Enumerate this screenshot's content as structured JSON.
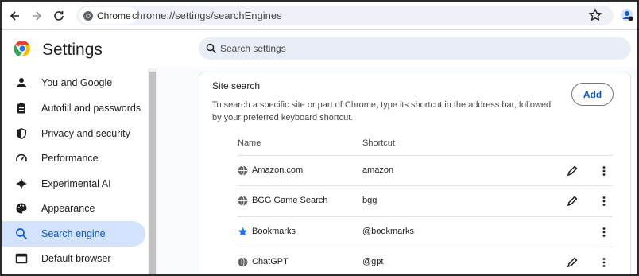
{
  "browser": {
    "chip_label": "Chrome",
    "url": "chrome://settings/searchEngines"
  },
  "header": {
    "title": "Settings",
    "search_placeholder": "Search settings"
  },
  "sidebar": {
    "items": [
      {
        "label": "You and Google",
        "icon": "person-icon"
      },
      {
        "label": "Autofill and passwords",
        "icon": "clipboard-icon"
      },
      {
        "label": "Privacy and security",
        "icon": "shield-icon"
      },
      {
        "label": "Performance",
        "icon": "gauge-icon"
      },
      {
        "label": "Experimental AI",
        "icon": "sparkle-icon"
      },
      {
        "label": "Appearance",
        "icon": "palette-icon"
      },
      {
        "label": "Search engine",
        "icon": "search-icon",
        "active": true
      },
      {
        "label": "Default browser",
        "icon": "browser-icon"
      }
    ]
  },
  "site_search": {
    "title": "Site search",
    "description": "To search a specific site or part of Chrome, type its shortcut in the address bar, followed by your preferred keyboard shortcut.",
    "add_label": "Add",
    "columns": {
      "name": "Name",
      "shortcut": "Shortcut"
    },
    "rows": [
      {
        "name": "Amazon.com",
        "shortcut": "amazon",
        "icon": "globe-icon",
        "editable": true
      },
      {
        "name": "BGG Game Search",
        "shortcut": "bgg",
        "icon": "globe-icon",
        "editable": true
      },
      {
        "name": "Bookmarks",
        "shortcut": "@bookmarks",
        "icon": "star-icon",
        "editable": false
      },
      {
        "name": "ChatGPT",
        "shortcut": "@gpt",
        "icon": "globe-icon",
        "editable": true
      }
    ]
  },
  "colors": {
    "accent": "#0b57d0",
    "active_bg": "#d3e3fd",
    "search_bg": "#e9eef6"
  }
}
